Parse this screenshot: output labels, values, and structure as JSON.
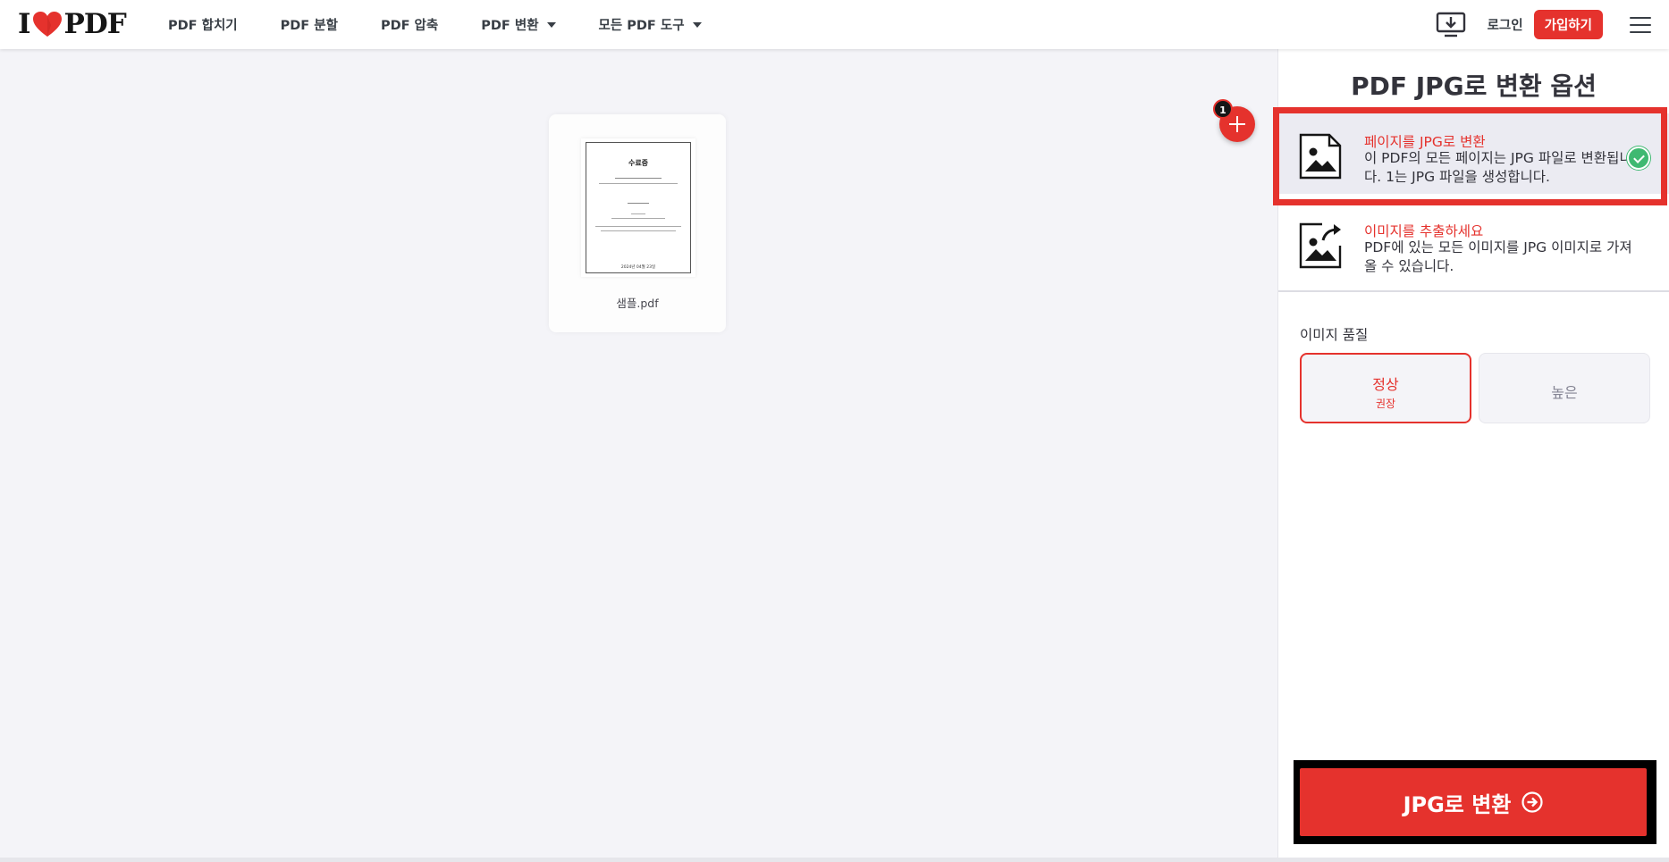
{
  "header": {
    "logo": {
      "before_heart": "I",
      "after_heart": "PDF"
    },
    "nav": [
      {
        "label": "PDF 합치기",
        "has_caret": false
      },
      {
        "label": "PDF 분할",
        "has_caret": false
      },
      {
        "label": "PDF 압축",
        "has_caret": false
      },
      {
        "label": "PDF 변환",
        "has_caret": true
      },
      {
        "label": "모든 PDF 도구",
        "has_caret": true
      }
    ],
    "download_icon": "desktop-download-icon",
    "login": "로그인",
    "signup": "가입하기",
    "menu_icon": "hamburger-menu-icon"
  },
  "workspace": {
    "file": {
      "name": "샘플.pdf",
      "thumbnail_title": "수료증",
      "thumbnail_date": "2024년 04월 23일"
    },
    "file_count_badge": "1",
    "add_icon": "plus-icon"
  },
  "sidebar": {
    "title": "PDF JPG로 변환 옵션",
    "options": [
      {
        "title": "페이지를 JPG로 변환",
        "desc": "이 PDF의 모든 페이지는 JPG 파일로 변환됩니다. 1는 JPG 파일을 생성합니다.",
        "icon": "image-file-icon",
        "selected": true
      },
      {
        "title": "이미지를 추출하세요",
        "desc": "PDF에 있는 모든 이미지를 JPG 이미지로 가져올 수 있습니다.",
        "icon": "image-extract-icon",
        "selected": false
      }
    ],
    "quality_label": "이미지 품질",
    "quality_options": [
      {
        "label": "정상",
        "sub": "권장",
        "active": true
      },
      {
        "label": "높은",
        "sub": "",
        "active": false
      }
    ],
    "convert_button": "JPG로 변환",
    "colors": {
      "accent": "#e5322d",
      "check": "#3fb971",
      "selected_bg": "#ebebf2"
    }
  }
}
